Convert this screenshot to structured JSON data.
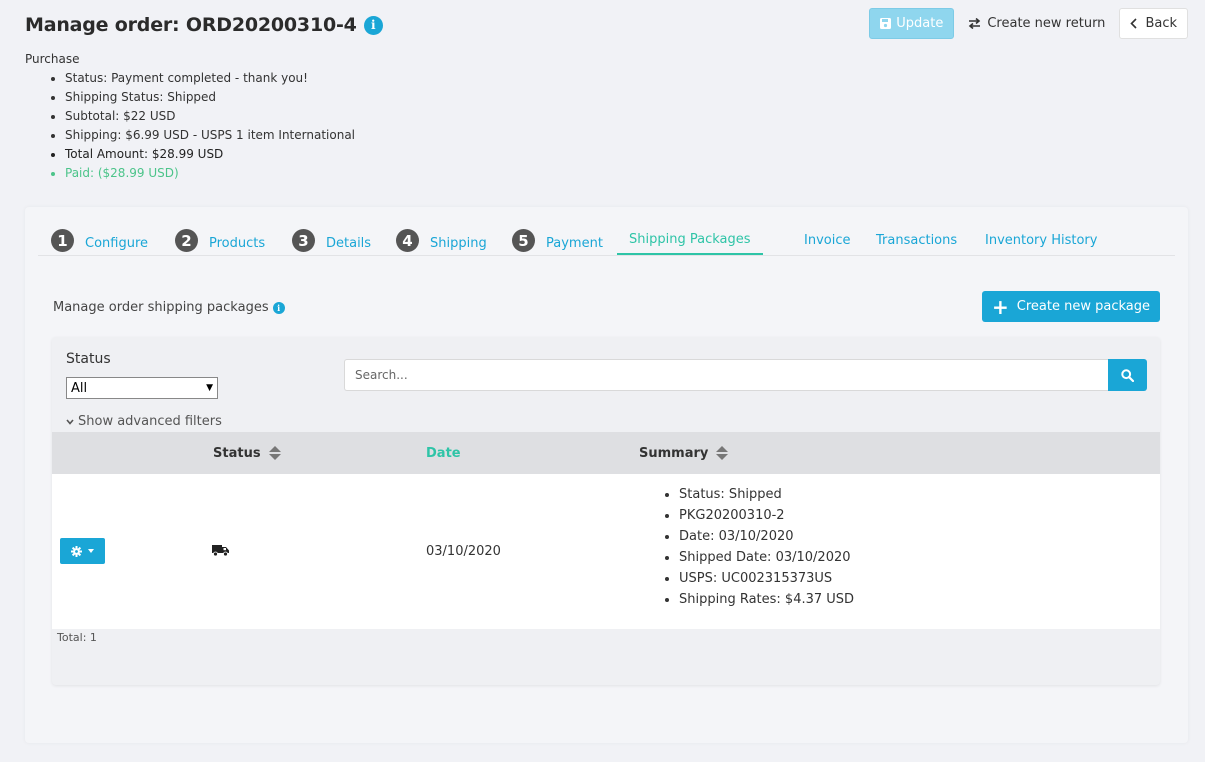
{
  "header": {
    "title": "Manage order: ORD20200310-4",
    "info_icon": "info-icon",
    "update_label": "Update",
    "create_return_label": "Create new return",
    "back_label": "Back"
  },
  "purchase": {
    "heading": "Purchase",
    "items": [
      {
        "text": "Status: Payment completed - thank you!",
        "style": "normal"
      },
      {
        "text": "Shipping Status: Shipped",
        "style": "normal"
      },
      {
        "text": "Subtotal: $22 USD",
        "style": "normal"
      },
      {
        "text": "Shipping: $6.99 USD - USPS 1 item International",
        "style": "normal"
      },
      {
        "text": "Total Amount: $28.99 USD",
        "style": "bold"
      },
      {
        "text": "Paid: ($28.99 USD)",
        "style": "paid"
      }
    ]
  },
  "tabs": [
    {
      "num": "1",
      "label": "Configure"
    },
    {
      "num": "2",
      "label": "Products"
    },
    {
      "num": "3",
      "label": "Details"
    },
    {
      "num": "4",
      "label": "Shipping"
    },
    {
      "num": "5",
      "label": "Payment"
    },
    {
      "num": "",
      "label": "Shipping Packages",
      "active": true
    },
    {
      "num": "",
      "label": "Invoice"
    },
    {
      "num": "",
      "label": "Transactions"
    },
    {
      "num": "",
      "label": "Inventory History"
    }
  ],
  "packages": {
    "manage_label": "Manage order shipping packages",
    "create_button": "Create new package",
    "filter": {
      "status_label": "Status",
      "status_value": "All",
      "search_placeholder": "Search...",
      "advanced_filters": "Show advanced filters"
    },
    "table": {
      "columns": [
        "Status",
        "Date",
        "Summary"
      ],
      "rows": [
        {
          "status_icon": "truck-icon",
          "date": "03/10/2020",
          "summary": [
            "Status: Shipped",
            "PKG20200310-2",
            "Date: 03/10/2020",
            "Shipped Date: 03/10/2020",
            "USPS: UC002315373US",
            "Shipping Rates: $4.37 USD"
          ]
        }
      ]
    },
    "total": "Total: 1"
  },
  "colors": {
    "accent": "#1aa6d6",
    "active_tab": "#2ec4a7",
    "paid": "#4cc48a"
  }
}
